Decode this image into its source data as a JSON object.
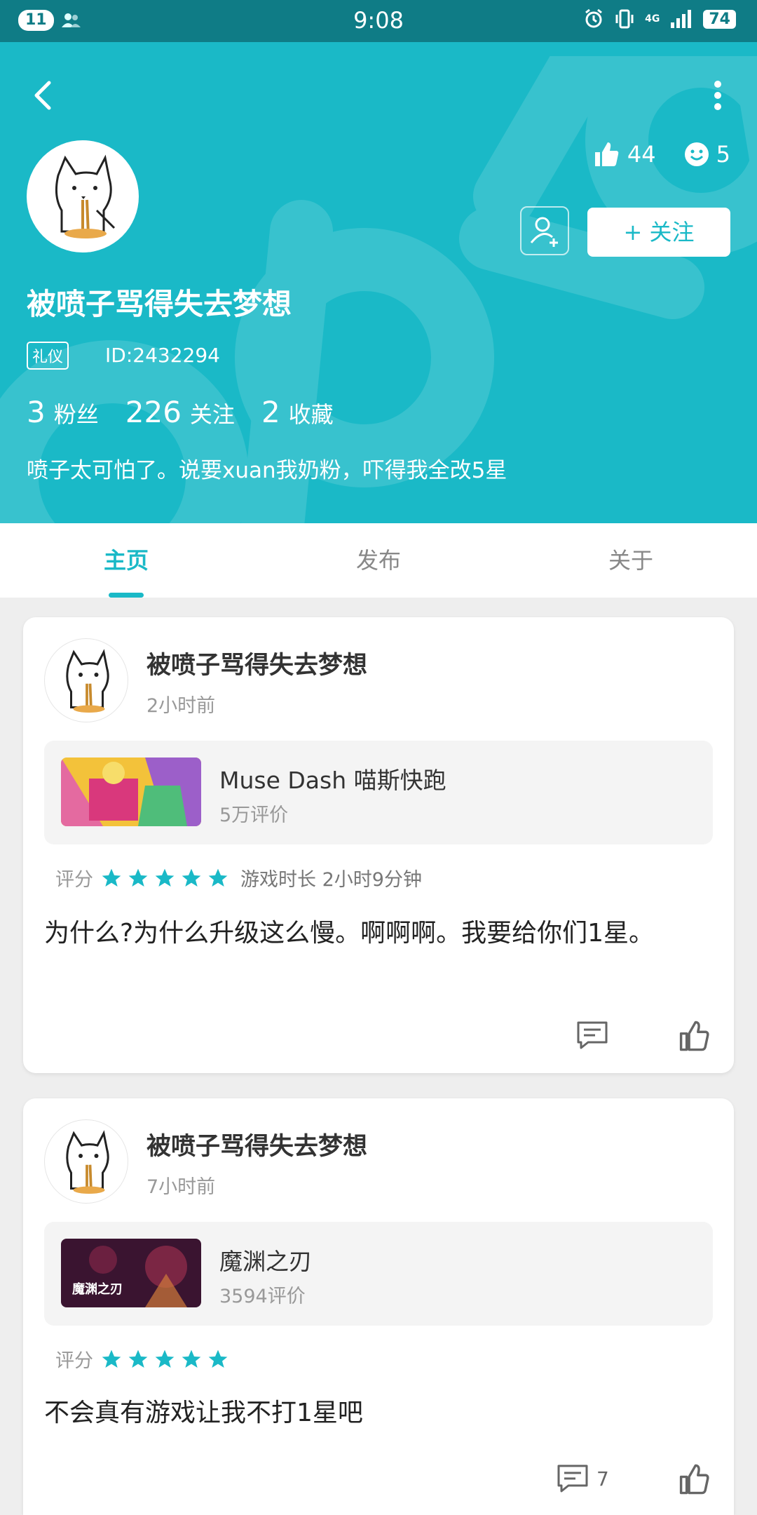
{
  "status_bar": {
    "notif_count": "11",
    "time": "9:08",
    "network": "4G",
    "battery": "74"
  },
  "header": {
    "likes": "44",
    "smiles": "5",
    "follow_label": "+ 关注",
    "username": "被喷子骂得失去梦想",
    "tag": "礼仪",
    "user_id": "ID:2432294",
    "counts": [
      {
        "num": "3",
        "label": "粉丝"
      },
      {
        "num": "226",
        "label": "关注"
      },
      {
        "num": "2",
        "label": "收藏"
      }
    ],
    "bio": "喷子太可怕了。说要xuan我奶粉，吓得我全改5星",
    "accent_color": "#1ab9c7"
  },
  "tabs": [
    {
      "label": "主页",
      "active": true
    },
    {
      "label": "发布",
      "active": false
    },
    {
      "label": "关于",
      "active": false
    }
  ],
  "posts": [
    {
      "author": "被喷子骂得失去梦想",
      "time": "2小时前",
      "game_name": "Muse Dash 喵斯快跑",
      "game_reviews": "5万评价",
      "rating_label": "评分",
      "stars": 5,
      "playtime": "游戏时长 2小时9分钟",
      "review": "为什么?为什么升级这么慢。啊啊啊。我要给你们1星。",
      "comment_count": ""
    },
    {
      "author": "被喷子骂得失去梦想",
      "time": "7小时前",
      "game_name": "魔渊之刃",
      "game_thumb_text": "魔渊之刃",
      "game_reviews": "3594评价",
      "rating_label": "评分",
      "stars": 5,
      "playtime": "",
      "review": "不会真有游戏让我不打1星吧",
      "comment_count": "7"
    }
  ]
}
